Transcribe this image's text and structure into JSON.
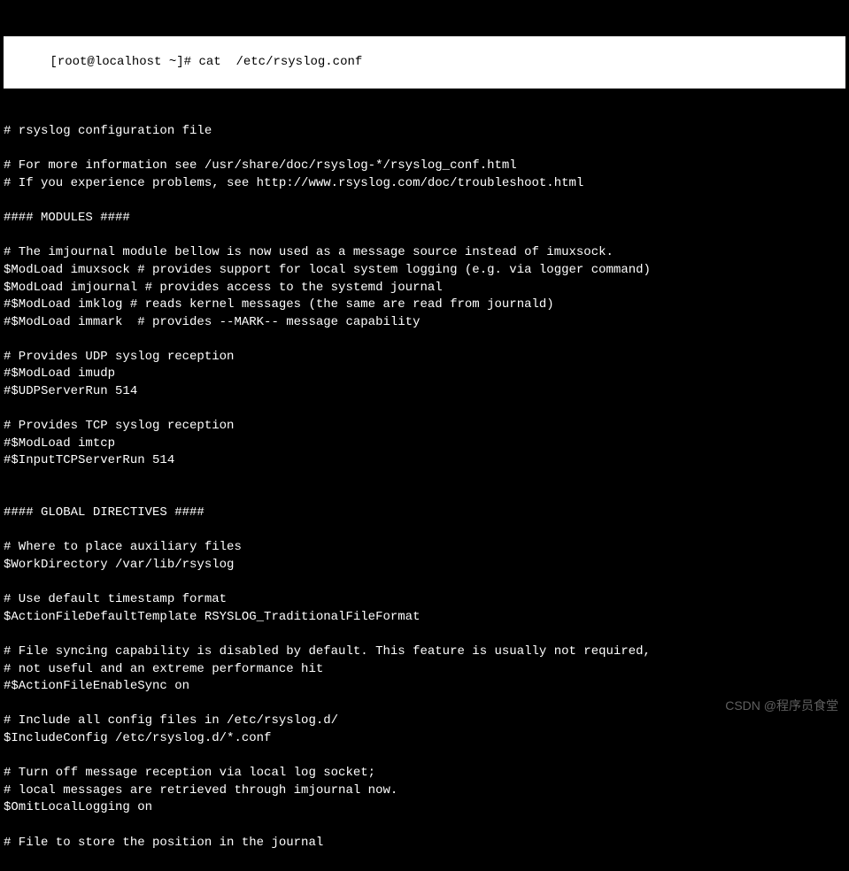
{
  "prompt": "[root@localhost ~]# ",
  "command": "cat  /etc/rsyslog.conf",
  "lines": [
    "# rsyslog configuration file",
    "",
    "# For more information see /usr/share/doc/rsyslog-*/rsyslog_conf.html",
    "# If you experience problems, see http://www.rsyslog.com/doc/troubleshoot.html",
    "",
    "#### MODULES ####",
    "",
    "# The imjournal module bellow is now used as a message source instead of imuxsock.",
    "$ModLoad imuxsock # provides support for local system logging (e.g. via logger command)",
    "$ModLoad imjournal # provides access to the systemd journal",
    "#$ModLoad imklog # reads kernel messages (the same are read from journald)",
    "#$ModLoad immark  # provides --MARK-- message capability",
    "",
    "# Provides UDP syslog reception",
    "#$ModLoad imudp",
    "#$UDPServerRun 514",
    "",
    "# Provides TCP syslog reception",
    "#$ModLoad imtcp",
    "#$InputTCPServerRun 514",
    "",
    "",
    "#### GLOBAL DIRECTIVES ####",
    "",
    "# Where to place auxiliary files",
    "$WorkDirectory /var/lib/rsyslog",
    "",
    "# Use default timestamp format",
    "$ActionFileDefaultTemplate RSYSLOG_TraditionalFileFormat",
    "",
    "# File syncing capability is disabled by default. This feature is usually not required,",
    "# not useful and an extreme performance hit",
    "#$ActionFileEnableSync on",
    "",
    "# Include all config files in /etc/rsyslog.d/",
    "$IncludeConfig /etc/rsyslog.d/*.conf",
    "",
    "# Turn off message reception via local log socket;",
    "# local messages are retrieved through imjournal now.",
    "$OmitLocalLogging on",
    "",
    "# File to store the position in the journal"
  ],
  "watermark": "CSDN @程序员食堂"
}
